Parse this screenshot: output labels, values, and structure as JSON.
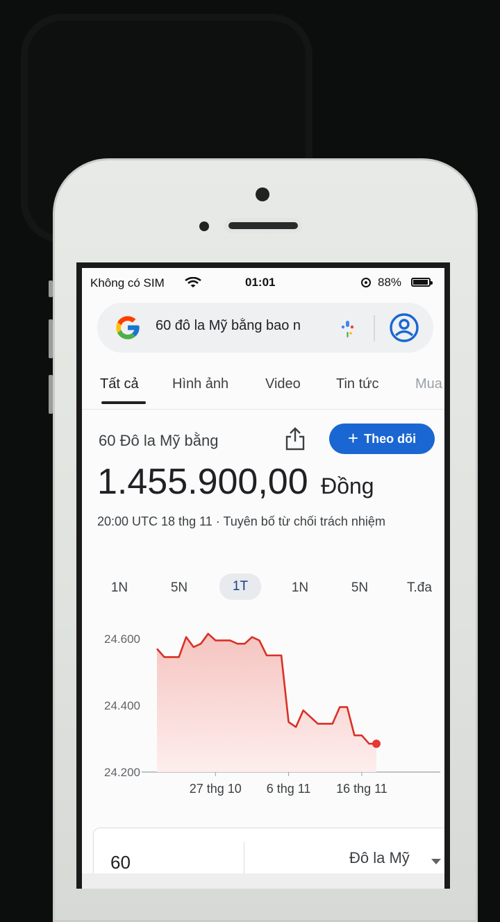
{
  "status_bar": {
    "carrier": "Không có SIM",
    "time": "01:01",
    "battery": "88%"
  },
  "search": {
    "query": "60 đô la Mỹ bằng bao n",
    "icons": [
      "google-logo-icon",
      "microphone-icon",
      "account-icon"
    ]
  },
  "tabs": [
    {
      "label": "Tất cả",
      "active": true
    },
    {
      "label": "Hình ảnh"
    },
    {
      "label": "Video"
    },
    {
      "label": "Tin tức"
    },
    {
      "label": "Mua"
    }
  ],
  "result": {
    "heading": "60 Đô la Mỹ bằng",
    "follow_label": "Theo dõi",
    "value": "1.455.900,00",
    "unit": "Đồng",
    "meta": "20:00 UTC 18 thg 11 · Tuyên bố từ chối trách nhiệm"
  },
  "ranges": [
    {
      "label": "1N"
    },
    {
      "label": "5N"
    },
    {
      "label": "1T",
      "active": true
    },
    {
      "label": "1N"
    },
    {
      "label": "5N"
    },
    {
      "label": "T.đa"
    }
  ],
  "chart_data": {
    "type": "area",
    "y_ticks": [
      "24.600",
      "24.400",
      "24.200"
    ],
    "y_tick_values": [
      24600,
      24400,
      24200
    ],
    "ylim": [
      24200,
      24600
    ],
    "x_labels": [
      "27 thg 10",
      "6 thg 11",
      "16 thg 11"
    ],
    "x_label_days": [
      8,
      18,
      28
    ],
    "values": [
      24570,
      24545,
      24545,
      24545,
      24605,
      24575,
      24585,
      24615,
      24595,
      24595,
      24595,
      24585,
      24585,
      24605,
      24595,
      24550,
      24550,
      24550,
      24350,
      24335,
      24385,
      24365,
      24345,
      24345,
      24345,
      24395,
      24395,
      24310,
      24310,
      24285,
      24285
    ],
    "colors": {
      "line": "#d93025",
      "fill": "#fbe3e1",
      "end_dot": "#e53935"
    }
  },
  "converter": {
    "amount": "60",
    "currency": "Đô la Mỹ"
  }
}
